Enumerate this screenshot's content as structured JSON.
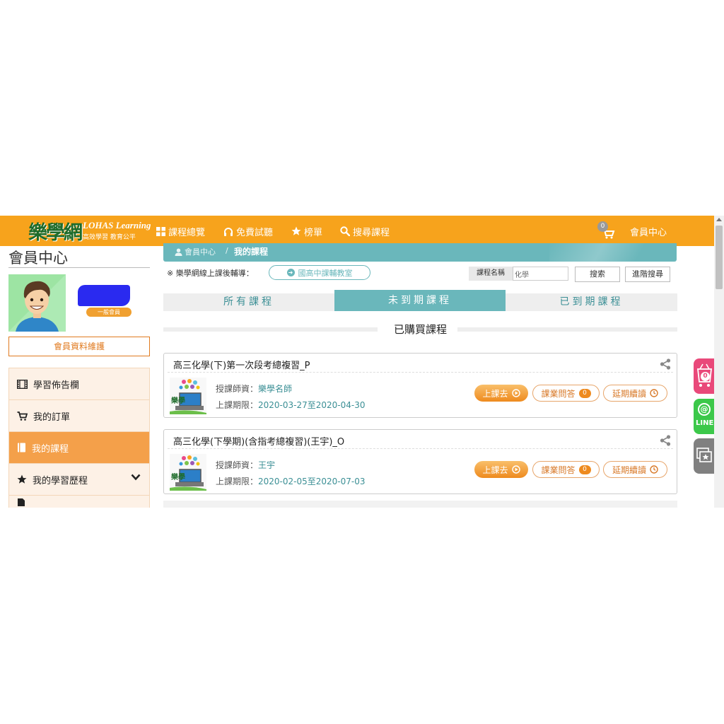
{
  "nav": {
    "logo_mark": "樂學網",
    "logo_en": "LOHAS Learning",
    "logo_sub": "高效學習 教育公平",
    "items": [
      {
        "label": "課程總覽",
        "icon": "grid-icon"
      },
      {
        "label": "免費試聽",
        "icon": "headphones-icon"
      },
      {
        "label": "榜單",
        "icon": "star-icon"
      },
      {
        "label": "搜尋課程",
        "icon": "search-icon"
      }
    ],
    "cart_count": "0",
    "member_center": "會員中心"
  },
  "sidebar": {
    "title": "會員中心",
    "user_name": "█████",
    "member_level": "一般會員",
    "profile_button": "會員資料維護",
    "menu": [
      {
        "label": "學習佈告欄",
        "icon": "film-icon",
        "active": false
      },
      {
        "label": "我的訂單",
        "icon": "cart-icon",
        "active": false
      },
      {
        "label": "我的課程",
        "icon": "book-icon",
        "active": true
      },
      {
        "label": "我的學習歷程",
        "icon": "star-icon",
        "active": false
      }
    ]
  },
  "breadcrumb": {
    "home": "會員中心",
    "separator": "/",
    "current": "我的課程"
  },
  "notice": {
    "text": "※ 樂學網線上課後輔導：",
    "button": "國高中課輔教室"
  },
  "search": {
    "label": "課程名稱",
    "value": "化學",
    "button": "搜索",
    "advanced": "進階搜尋"
  },
  "tabs": [
    {
      "label": "所有課程",
      "active": false
    },
    {
      "label": "未到期課程",
      "active": true
    },
    {
      "label": "已到期課程",
      "active": false
    }
  ],
  "section_title": "已購買課程",
  "courses": [
    {
      "title": "高三化學(下)第一次段考總複習_P",
      "teacher_label": "授課師資：",
      "teacher": "樂學名師",
      "period_label": "上課期限：",
      "period": "2020-03-27至2020-04-30",
      "go": "上課去",
      "qa": "課業問答",
      "qa_count": "0",
      "extend": "延期續讀"
    },
    {
      "title": "高三化學(下學期)(含指考總複習)(王宇)_O",
      "teacher_label": "授課師資：",
      "teacher": "王宇",
      "period_label": "上課期限：",
      "period": "2020-02-05至2020-07-03",
      "go": "上課去",
      "qa": "課業問答",
      "qa_count": "0",
      "extend": "延期續讀"
    }
  ],
  "floating": {
    "cart_count": "0",
    "line_label": "LINE"
  },
  "colors": {
    "brand_orange": "#f7a31c",
    "teal": "#6ab7bb",
    "menu_active": "#f4a04a"
  }
}
